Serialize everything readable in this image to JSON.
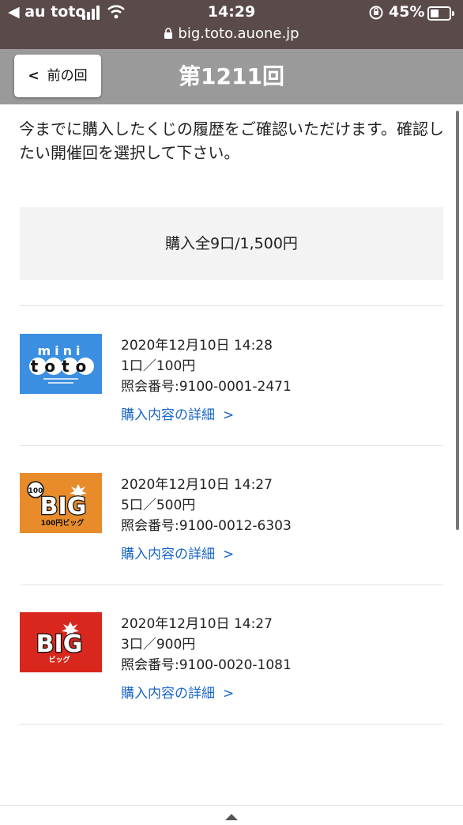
{
  "status_bar": {
    "carrier": "◀ au toto",
    "time": "14:29",
    "battery_percent": "45%",
    "battery_level": 0.45,
    "url": "big.toto.auone.jp"
  },
  "header": {
    "back_label": "前の回",
    "back_chevron": "<",
    "title": "第1211回"
  },
  "intro_text": "今までに購入したくじの履歴をご確認いただけます。確認したい開催回を選択して下さい。",
  "total_label": "購入全9口/1,500円",
  "entries": [
    {
      "product": "mini toto",
      "logo_icon": "mini-toto-logo",
      "logo_color": "#3b8fe0",
      "datetime": "2020年12月10日 14:28",
      "amount": "1口／100円",
      "ref": "照会番号:9100-0001-2471",
      "link": "購入内容の詳細",
      "logo_text_top": "mini",
      "logo_text_main": "toto"
    },
    {
      "product": "100円BIG",
      "logo_icon": "100yen-big-logo",
      "logo_color": "#e88b2a",
      "datetime": "2020年12月10日 14:27",
      "amount": "5口／500円",
      "ref": "照会番号:9100-0012-6303",
      "link": "購入内容の詳細",
      "logo_text_main": "BIG",
      "logo_text_sub": "100円ビッグ",
      "logo_text_badge": "100"
    },
    {
      "product": "BIG",
      "logo_icon": "big-logo",
      "logo_color": "#d9271d",
      "datetime": "2020年12月10日 14:27",
      "amount": "3口／900円",
      "ref": "照会番号:9100-0020-1081",
      "link": "購入内容の詳細",
      "logo_text_main": "BIG",
      "logo_text_sub": "ビッグ"
    }
  ],
  "link_arrow": ">"
}
